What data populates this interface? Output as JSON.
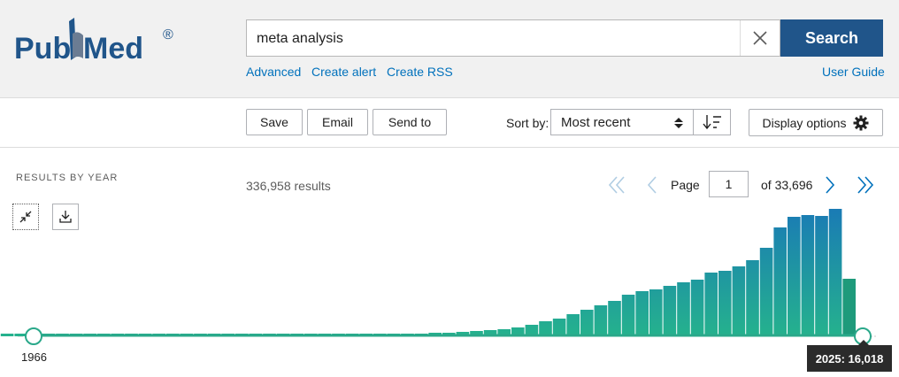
{
  "brand": {
    "name_part1": "Pub",
    "name_part2": "Med",
    "registered": "®"
  },
  "search": {
    "query": "meta analysis",
    "button": "Search"
  },
  "header_links": {
    "advanced": "Advanced",
    "create_alert": "Create alert",
    "create_rss": "Create RSS",
    "user_guide": "User Guide"
  },
  "toolbar": {
    "save": "Save",
    "email": "Email",
    "send_to": "Send to",
    "sort_by_label": "Sort by:",
    "sort_value": "Most recent",
    "display_options": "Display options"
  },
  "timeline": {
    "title": "RESULTS BY YEAR",
    "start_year": "1966",
    "tooltip": "2025: 16,018",
    "bar_counts_relative": [
      1,
      1,
      1,
      1,
      1,
      1,
      1,
      1,
      1,
      1,
      1,
      1,
      1,
      1,
      1,
      1,
      1,
      1,
      1,
      1,
      1,
      1,
      1,
      1,
      1,
      2,
      2,
      2,
      2,
      3,
      3,
      3,
      4,
      4,
      5,
      6,
      7,
      8,
      10,
      13,
      17,
      20,
      25,
      30,
      35,
      40,
      47,
      51,
      53,
      57,
      61,
      64,
      72,
      74,
      79,
      86,
      100,
      123,
      135,
      137,
      136,
      144,
      65
    ],
    "colors": {
      "teal": "#25b28d",
      "blue": "#1a7bb5",
      "last": "#1e9a7b",
      "line": "#2aa88a"
    }
  },
  "results": {
    "count": "336,958 results"
  },
  "pagination": {
    "page_label": "Page",
    "current": "1",
    "of_total": "of 33,696"
  }
}
